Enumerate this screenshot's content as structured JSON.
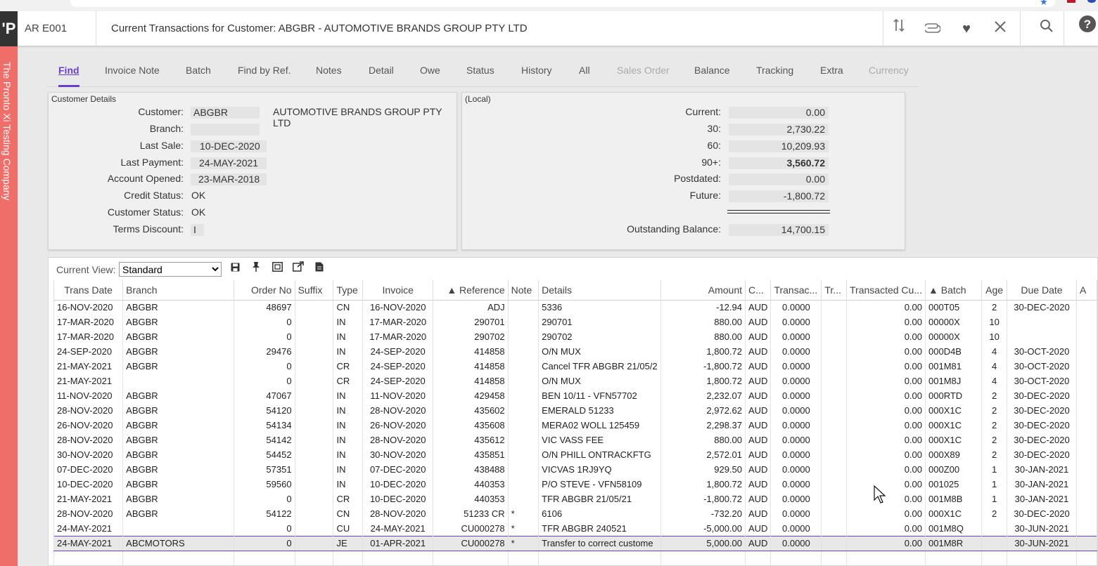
{
  "header": {
    "logo": "'P",
    "screen_code": "AR E001",
    "title": "Current Transactions for Customer: ABGBR - AUTOMOTIVE BRANDS GROUP PTY LTD"
  },
  "sidebar": {
    "company": "The Pronto Xi Testing Company"
  },
  "tabs": [
    {
      "label": "Find",
      "state": "active"
    },
    {
      "label": "Invoice Note",
      "state": "normal"
    },
    {
      "label": "Batch",
      "state": "normal"
    },
    {
      "label": "Find by Ref.",
      "state": "normal"
    },
    {
      "label": "Notes",
      "state": "normal"
    },
    {
      "label": "Detail",
      "state": "normal"
    },
    {
      "label": "Owe",
      "state": "normal"
    },
    {
      "label": "Status",
      "state": "normal"
    },
    {
      "label": "History",
      "state": "normal"
    },
    {
      "label": "All",
      "state": "normal"
    },
    {
      "label": "Sales Order",
      "state": "disabled"
    },
    {
      "label": "Balance",
      "state": "normal"
    },
    {
      "label": "Tracking",
      "state": "normal"
    },
    {
      "label": "Extra",
      "state": "normal"
    },
    {
      "label": "Currency",
      "state": "disabled"
    }
  ],
  "customer": {
    "caption": "Customer Details",
    "customer_label": "Customer:",
    "customer_code": "ABGBR",
    "customer_name": "AUTOMOTIVE BRANDS GROUP PTY LTD",
    "branch_label": "Branch:",
    "branch": "",
    "last_sale_label": "Last Sale:",
    "last_sale": "10-DEC-2020",
    "last_payment_label": "Last Payment:",
    "last_payment": "24-MAY-2021",
    "account_opened_label": "Account Opened:",
    "account_opened": "23-MAR-2018",
    "credit_status_label": "Credit Status:",
    "credit_status": "OK",
    "customer_status_label": "Customer Status:",
    "customer_status": "OK",
    "terms_discount_label": "Terms Discount:",
    "terms_discount": "I"
  },
  "aging": {
    "caption": "(Local)",
    "current_label": "Current:",
    "current": "0.00",
    "d30_label": "30:",
    "d30": "2,730.22",
    "d60_label": "60:",
    "d60": "10,209.93",
    "d90_label": "90+:",
    "d90": "3,560.72",
    "postdated_label": "Postdated:",
    "postdated": "0.00",
    "future_label": "Future:",
    "future": "-1,800.72",
    "outstanding_label": "Outstanding Balance:",
    "outstanding": "14,700.15"
  },
  "grid": {
    "view_label": "Current View:",
    "view_options": [
      "Standard"
    ],
    "columns": [
      "Trans Date",
      "Branch",
      "Order No",
      "Suffix",
      "Type",
      "Invoice",
      "▲ Reference",
      "Note",
      "Details",
      "Amount",
      "C...",
      "Transac...",
      "Tr...",
      "Transacted Cu...",
      "▲ Batch",
      "Age",
      "Due Date",
      "A"
    ],
    "rows": [
      [
        "16-NOV-2020",
        "ABGBR",
        "48697",
        "",
        "CN",
        "16-NOV-2020",
        "ADJ",
        "",
        "5336",
        "-12.94",
        "AUD",
        "0.0000",
        "",
        "0.00",
        "000T05",
        "2",
        "30-DEC-2020",
        ""
      ],
      [
        "17-MAR-2020",
        "ABGBR",
        "0",
        "",
        "IN",
        "17-MAR-2020",
        "290701",
        "",
        "290701",
        "880.00",
        "AUD",
        "0.0000",
        "",
        "0.00",
        "00000X",
        "10",
        "",
        ""
      ],
      [
        "17-MAR-2020",
        "ABGBR",
        "0",
        "",
        "IN",
        "17-MAR-2020",
        "290702",
        "",
        "290702",
        "880.00",
        "AUD",
        "0.0000",
        "",
        "0.00",
        "00000X",
        "10",
        "",
        ""
      ],
      [
        "24-SEP-2020",
        "ABGBR",
        "29476",
        "",
        "IN",
        "24-SEP-2020",
        "414858",
        "",
        "O/N MUX",
        "1,800.72",
        "AUD",
        "0.0000",
        "",
        "0.00",
        "000D4B",
        "4",
        "30-OCT-2020",
        ""
      ],
      [
        "21-MAY-2021",
        "ABGBR",
        "0",
        "",
        "CR",
        "24-SEP-2020",
        "414858",
        "",
        "Cancel TFR ABGBR 21/05/2",
        "-1,800.72",
        "AUD",
        "0.0000",
        "",
        "0.00",
        "001M81",
        "4",
        "30-OCT-2020",
        ""
      ],
      [
        "21-MAY-2021",
        "",
        "0",
        "",
        "CR",
        "24-SEP-2020",
        "414858",
        "",
        "O/N MUX",
        "1,800.72",
        "AUD",
        "0.0000",
        "",
        "0.00",
        "001M8J",
        "4",
        "30-OCT-2020",
        ""
      ],
      [
        "11-NOV-2020",
        "ABGBR",
        "47067",
        "",
        "IN",
        "11-NOV-2020",
        "429458",
        "",
        "BEN 10/11 - VFN57702",
        "2,232.07",
        "AUD",
        "0.0000",
        "",
        "0.00",
        "000RTD",
        "2",
        "30-DEC-2020",
        ""
      ],
      [
        "28-NOV-2020",
        "ABGBR",
        "54120",
        "",
        "IN",
        "28-NOV-2020",
        "435602",
        "",
        "EMERALD 51233",
        "2,972.62",
        "AUD",
        "0.0000",
        "",
        "0.00",
        "000X1C",
        "2",
        "30-DEC-2020",
        ""
      ],
      [
        "26-NOV-2020",
        "ABGBR",
        "54134",
        "",
        "IN",
        "26-NOV-2020",
        "435608",
        "",
        "MERA02  WOLL 125459",
        "2,298.37",
        "AUD",
        "0.0000",
        "",
        "0.00",
        "000X1C",
        "2",
        "30-DEC-2020",
        ""
      ],
      [
        "28-NOV-2020",
        "ABGBR",
        "54142",
        "",
        "IN",
        "28-NOV-2020",
        "435612",
        "",
        "VIC VASS FEE",
        "880.00",
        "AUD",
        "0.0000",
        "",
        "0.00",
        "000X1C",
        "2",
        "30-DEC-2020",
        ""
      ],
      [
        "30-NOV-2020",
        "ABGBR",
        "54452",
        "",
        "IN",
        "30-NOV-2020",
        "435851",
        "",
        "O/N PHILL ONTRACKFTG",
        "2,572.01",
        "AUD",
        "0.0000",
        "",
        "0.00",
        "000X89",
        "2",
        "30-DEC-2020",
        ""
      ],
      [
        "07-DEC-2020",
        "ABGBR",
        "57351",
        "",
        "IN",
        "07-DEC-2020",
        "438488",
        "",
        "VICVAS 1RJ9YQ",
        "929.50",
        "AUD",
        "0.0000",
        "",
        "0.00",
        "000Z00",
        "1",
        "30-JAN-2021",
        ""
      ],
      [
        "10-DEC-2020",
        "ABGBR",
        "59560",
        "",
        "IN",
        "10-DEC-2020",
        "440353",
        "",
        "P/O STEVE - VFN58109",
        "1,800.72",
        "AUD",
        "0.0000",
        "",
        "0.00",
        "001025",
        "1",
        "30-JAN-2021",
        ""
      ],
      [
        "21-MAY-2021",
        "ABGBR",
        "0",
        "",
        "CR",
        "10-DEC-2020",
        "440353",
        "",
        "TFR ABGBR 21/05/21",
        "-1,800.72",
        "AUD",
        "0.0000",
        "",
        "0.00",
        "001M8B",
        "1",
        "30-JAN-2021",
        ""
      ],
      [
        "28-NOV-2020",
        "ABGBR",
        "54122",
        "",
        "CN",
        "28-NOV-2020",
        "51233 CR",
        "*",
        "6106",
        "-732.20",
        "AUD",
        "0.0000",
        "",
        "0.00",
        "000X1C",
        "2",
        "30-DEC-2020",
        ""
      ],
      [
        "24-MAY-2021",
        "",
        "0",
        "",
        "CU",
        "24-MAY-2021",
        "CU000278",
        "*",
        "TFR ABGBR 240521",
        "-5,000.00",
        "AUD",
        "0.0000",
        "",
        "0.00",
        "001M8Q",
        "",
        "30-JUN-2021",
        ""
      ],
      [
        "24-MAY-2021",
        "ABCMOTORS",
        "0",
        "",
        "JE",
        "01-APR-2021",
        "CU000278",
        "*",
        "Transfer to correct custome",
        "5,000.00",
        "AUD",
        "0.0000",
        "",
        "0.00",
        "001M8R",
        "",
        "30-JUN-2021",
        ""
      ]
    ],
    "selected_row": 16
  }
}
